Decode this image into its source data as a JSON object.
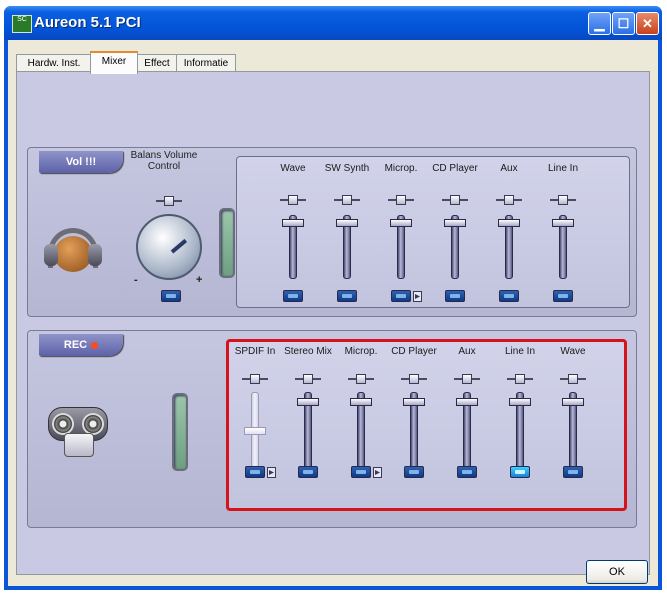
{
  "window": {
    "title": "Aureon 5.1 PCI",
    "controls": [
      "minimize-icon",
      "maximize-icon",
      "close-icon"
    ],
    "icon_text": "SC"
  },
  "tabs": [
    {
      "label": "Hardw. Inst.",
      "active": false
    },
    {
      "label": "Mixer",
      "active": true
    },
    {
      "label": "Effect",
      "active": false
    },
    {
      "label": "Informatie",
      "active": false
    }
  ],
  "playback": {
    "title": "Vol !!!",
    "balance_label": "Balans Volume Control",
    "knob_minus": "-",
    "knob_plus": "+",
    "channels": [
      {
        "label": "Wave",
        "level": 0.92,
        "muted": false,
        "boost": false
      },
      {
        "label": "SW Synth",
        "level": 0.92,
        "muted": false,
        "boost": false
      },
      {
        "label": "Microp.",
        "level": 0.92,
        "muted": false,
        "boost": true
      },
      {
        "label": "CD Player",
        "level": 0.92,
        "muted": false,
        "boost": false
      },
      {
        "label": "Aux",
        "level": 0.92,
        "muted": false,
        "boost": false
      },
      {
        "label": "Line In",
        "level": 0.92,
        "muted": false,
        "boost": false
      }
    ]
  },
  "recording": {
    "title": "REC",
    "channels": [
      {
        "label": "SPDIF In",
        "level": 0.55,
        "muted": false,
        "boost": true,
        "disabled": true
      },
      {
        "label": "Stereo Mix",
        "level": 0.92,
        "muted": false,
        "boost": false,
        "disabled": false
      },
      {
        "label": "Microp.",
        "level": 0.92,
        "muted": false,
        "boost": true,
        "disabled": false
      },
      {
        "label": "CD Player",
        "level": 0.92,
        "muted": false,
        "boost": false,
        "disabled": false
      },
      {
        "label": "Aux",
        "level": 0.92,
        "muted": false,
        "boost": false,
        "disabled": false
      },
      {
        "label": "Line In",
        "level": 0.92,
        "muted": false,
        "boost": false,
        "disabled": false,
        "selected": true
      },
      {
        "label": "Wave",
        "level": 0.92,
        "muted": false,
        "boost": false,
        "disabled": false
      }
    ]
  },
  "buttons": {
    "ok": "OK"
  },
  "colors": {
    "highlight_border": "#d6131b",
    "titlebar": "#0a56d8",
    "panel_bg": "#c9c9e4"
  }
}
